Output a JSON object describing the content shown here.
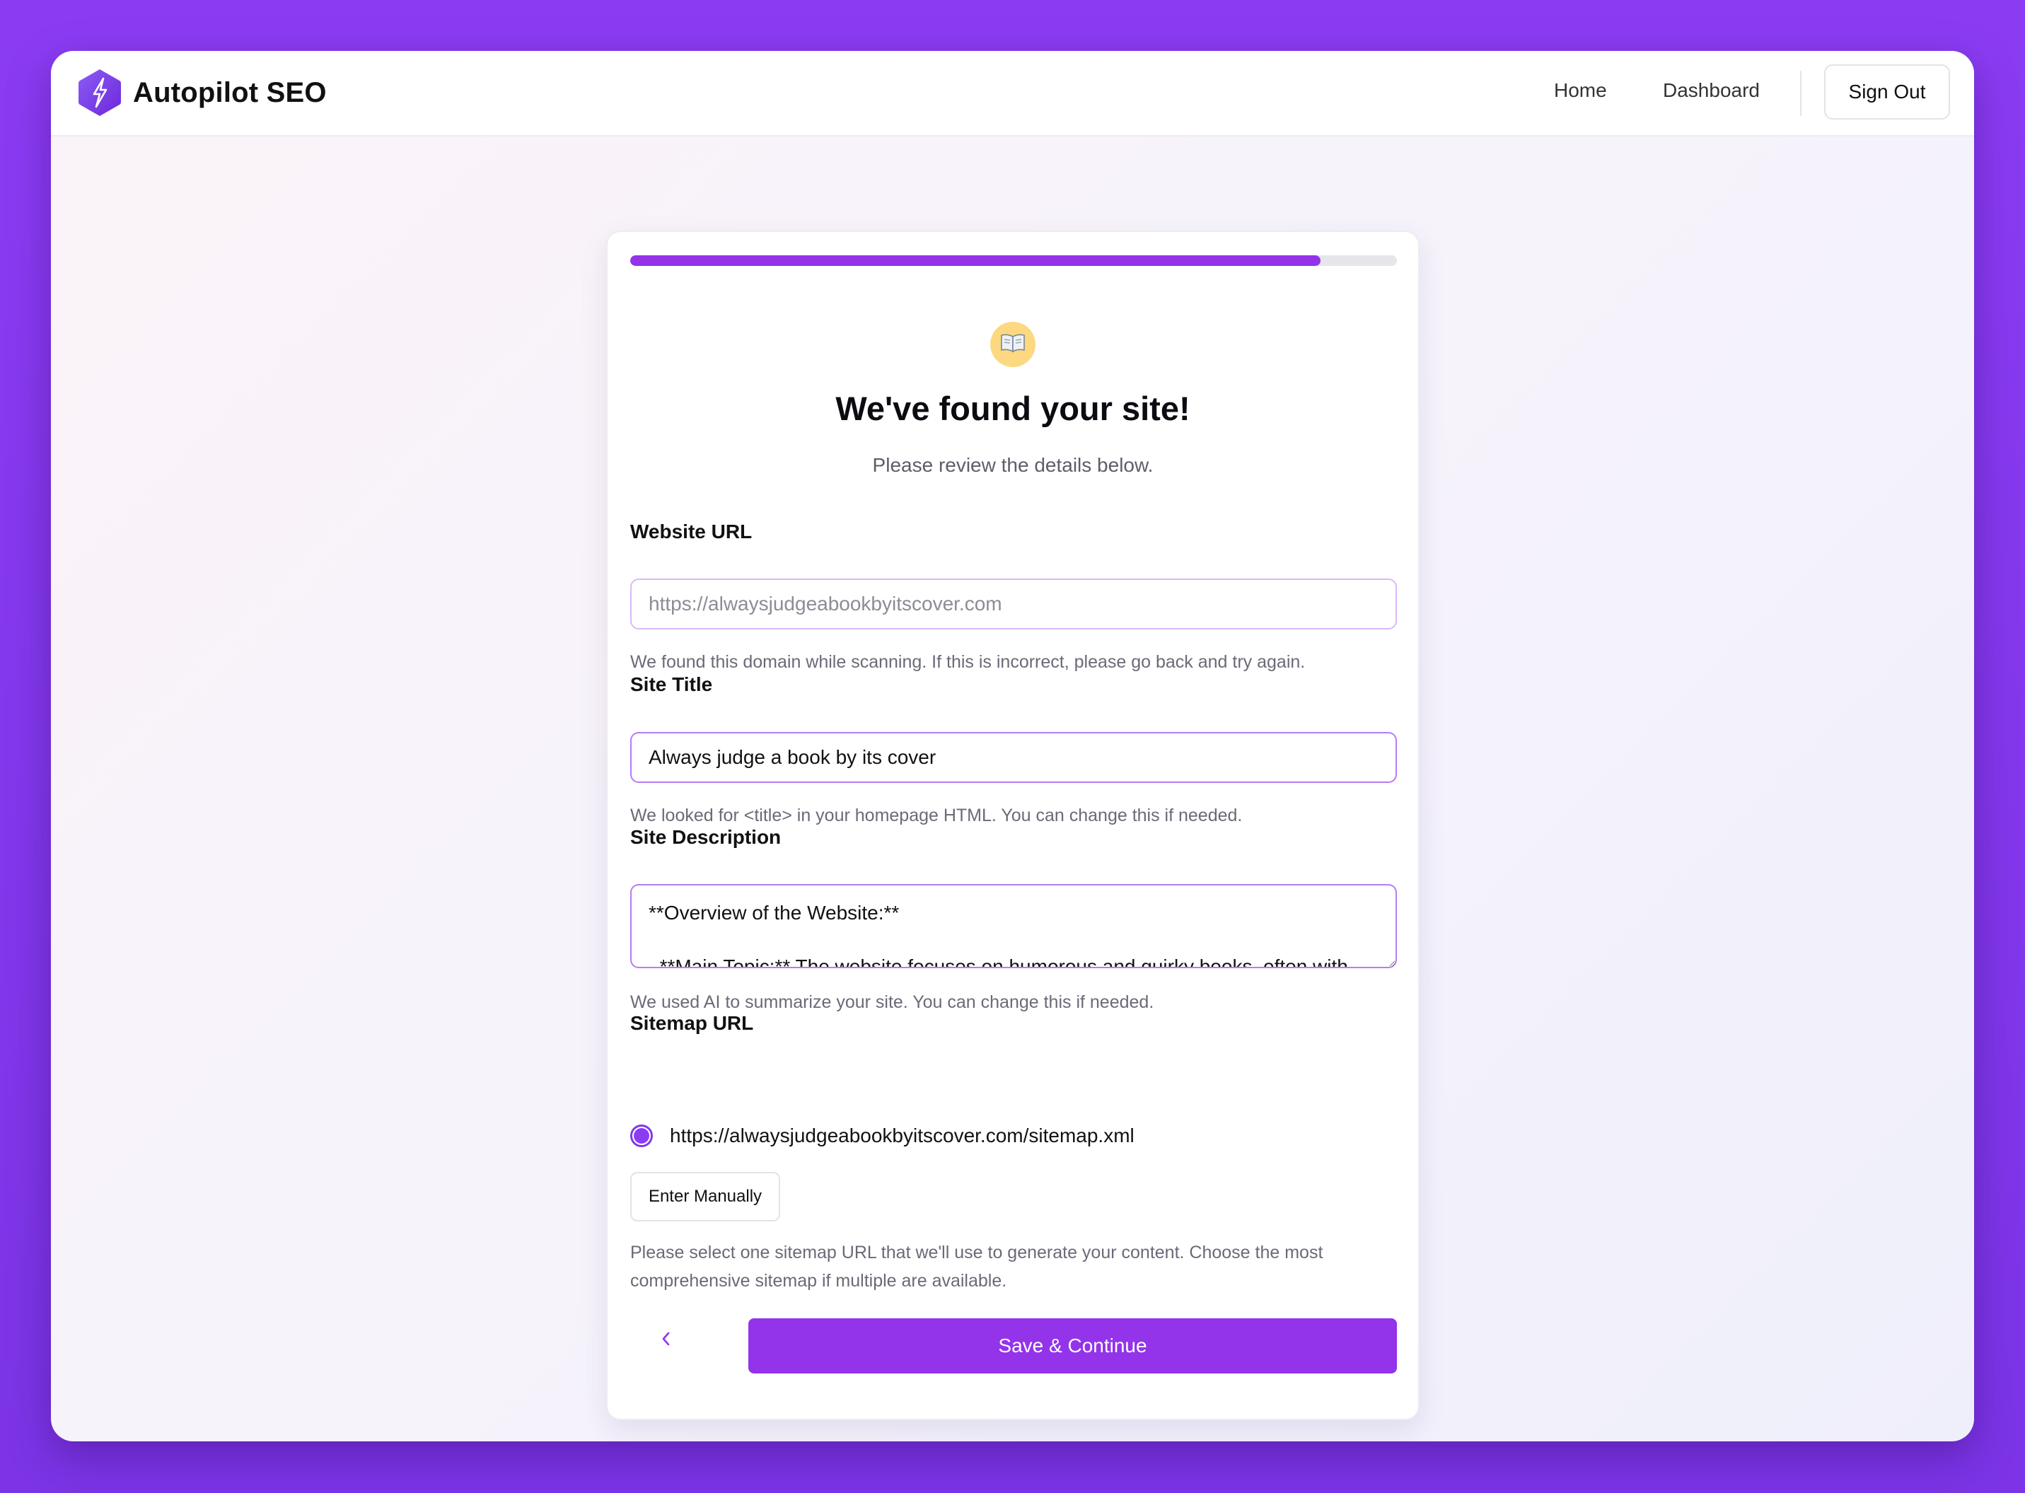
{
  "app": {
    "name": "Autopilot SEO",
    "logo_icon": "lightning-hexagon-icon",
    "accent_color": "#9333ea"
  },
  "nav": {
    "home": "Home",
    "dashboard": "Dashboard",
    "sign_out": "Sign Out"
  },
  "onboarding": {
    "progress": 0.9,
    "emoji_icon": "open-book-icon",
    "heading": "We've found your site!",
    "subheading": "Please review the details below.",
    "website_url": {
      "label": "Website URL",
      "placeholder": "https://alwaysjudgeabookbyitscover.com",
      "help": "We found this domain while scanning. If this is incorrect, please go back and try again."
    },
    "site_title": {
      "label": "Site Title",
      "value": "Always judge a book by its cover",
      "help": "We looked for <title> in your homepage HTML. You can change this if needed."
    },
    "site_description": {
      "label": "Site Description",
      "value": "**Overview of the Website:**\n\n  **Main Topic:** The website focuses on humorous and quirky books, often with",
      "help": "We used AI to summarize your site. You can change this if needed."
    },
    "sitemap": {
      "label": "Sitemap URL",
      "option": "https://alwaysjudgeabookbyitscover.com/sitemap.xml",
      "selected": true,
      "manual_button": "Enter Manually",
      "help": "Please select one sitemap URL that we'll use to generate your content. Choose the most comprehensive sitemap if multiple are available."
    },
    "back_icon": "chevron-left-icon",
    "save_button": "Save & Continue"
  }
}
